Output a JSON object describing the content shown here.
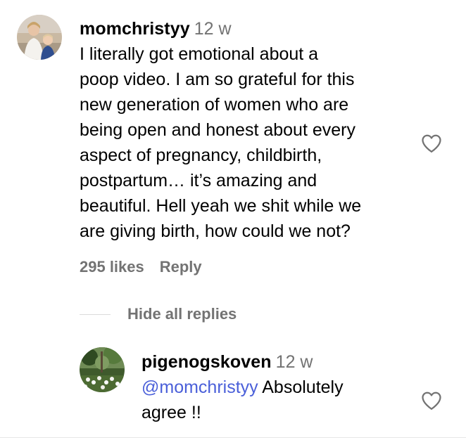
{
  "comment": {
    "username": "momchristyy",
    "time": "12 w",
    "lines": [
      "I literally got emotional about a",
      "poop video. I am so grateful for this",
      "new generation of women who are",
      "being open and honest about every",
      "aspect of pregnancy, childbirth,",
      "postpartum… it’s amazing and",
      "beautiful. Hell yeah we shit while we",
      "are giving birth, how could we not?"
    ],
    "likes": "295 likes",
    "reply_label": "Reply"
  },
  "replies_toggle": {
    "label": "Hide all replies"
  },
  "reply": {
    "username": "pigenogskoven",
    "time": "12 w",
    "mention": "@momchristyy",
    "text_after_mention": "Absolutely",
    "line2": "agree !!"
  },
  "icons": {
    "heart": "heart-outline-icon"
  },
  "colors": {
    "secondary_text": "#737373",
    "mention": "#4a5fd9",
    "divider": "#dbdbdb"
  }
}
